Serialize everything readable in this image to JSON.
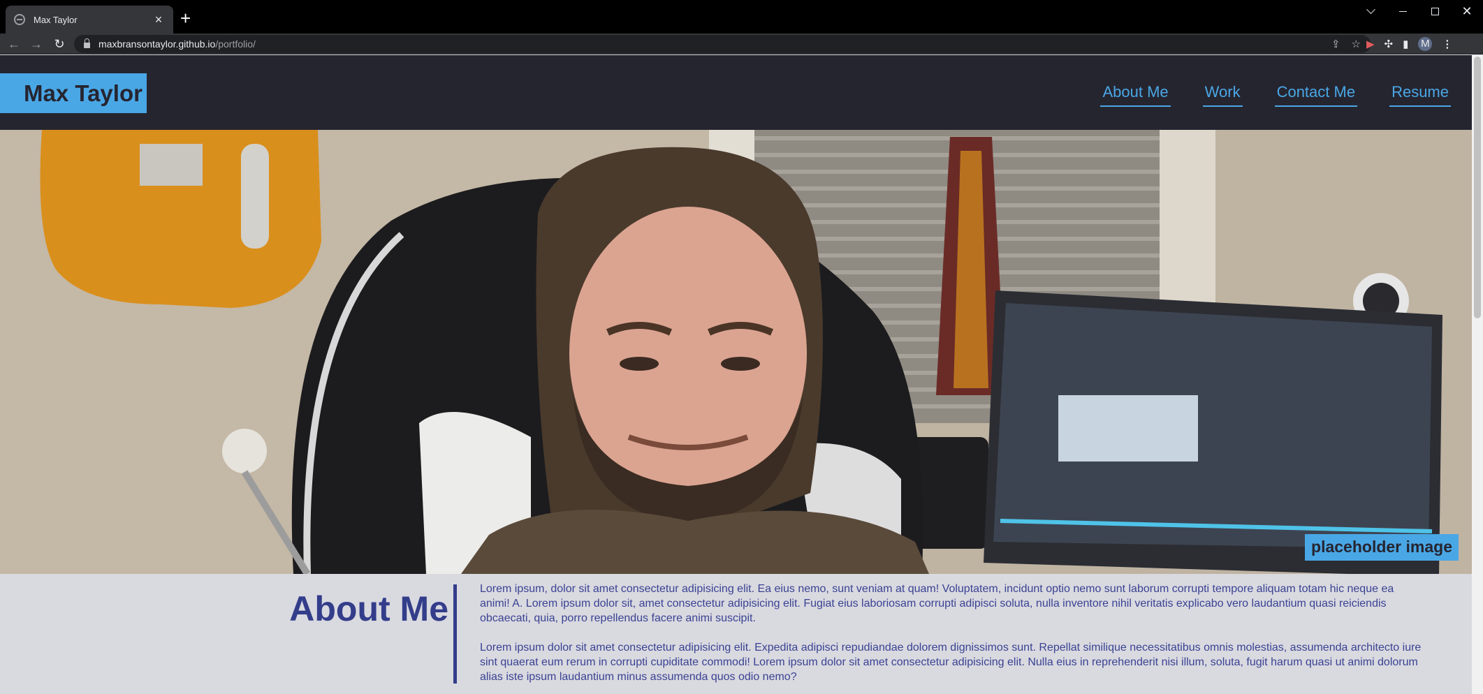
{
  "browser": {
    "tab_title": "Max Taylor",
    "new_tab": "+",
    "url_host": "maxbransontaylor.github.io",
    "url_path": "/portfolio/",
    "profile_initial": "M"
  },
  "site": {
    "brand": "Max Taylor",
    "nav": [
      "About Me",
      "Work",
      "Contact Me",
      "Resume"
    ],
    "hero_caption": "placeholder image",
    "about": {
      "title": "About Me",
      "paragraphs": [
        "Lorem ipsum, dolor sit amet consectetur adipisicing elit. Ea eius nemo, sunt veniam at quam! Voluptatem, incidunt optio nemo sunt laborum corrupti tempore aliquam totam hic neque ea animi! A. Lorem ipsum dolor sit, amet consectetur adipisicing elit. Fugiat eius laboriosam corrupti adipisci soluta, nulla inventore nihil veritatis explicabo vero laudantium quasi reiciendis obcaecati, quia, porro repellendus facere animi suscipit.",
        "Lorem ipsum dolor sit amet consectetur adipisicing elit. Expedita adipisci repudiandae dolorem dignissimos sunt. Repellat similique necessitatibus omnis molestias, assumenda architecto iure sint quaerat eum rerum in corrupti cupiditate commodi! Lorem ipsum dolor sit amet consectetur adipisicing elit. Nulla eius in reprehenderit nisi illum, soluta, fugit harum quasi ut animi dolorum alias iste ipsum laudantium minus assumenda quos odio nemo?"
      ]
    }
  },
  "colors": {
    "header_bg": "#252530",
    "accent_blue": "#4aa7e6",
    "about_bg": "#d9d9e0",
    "about_text": "#333d8a"
  }
}
